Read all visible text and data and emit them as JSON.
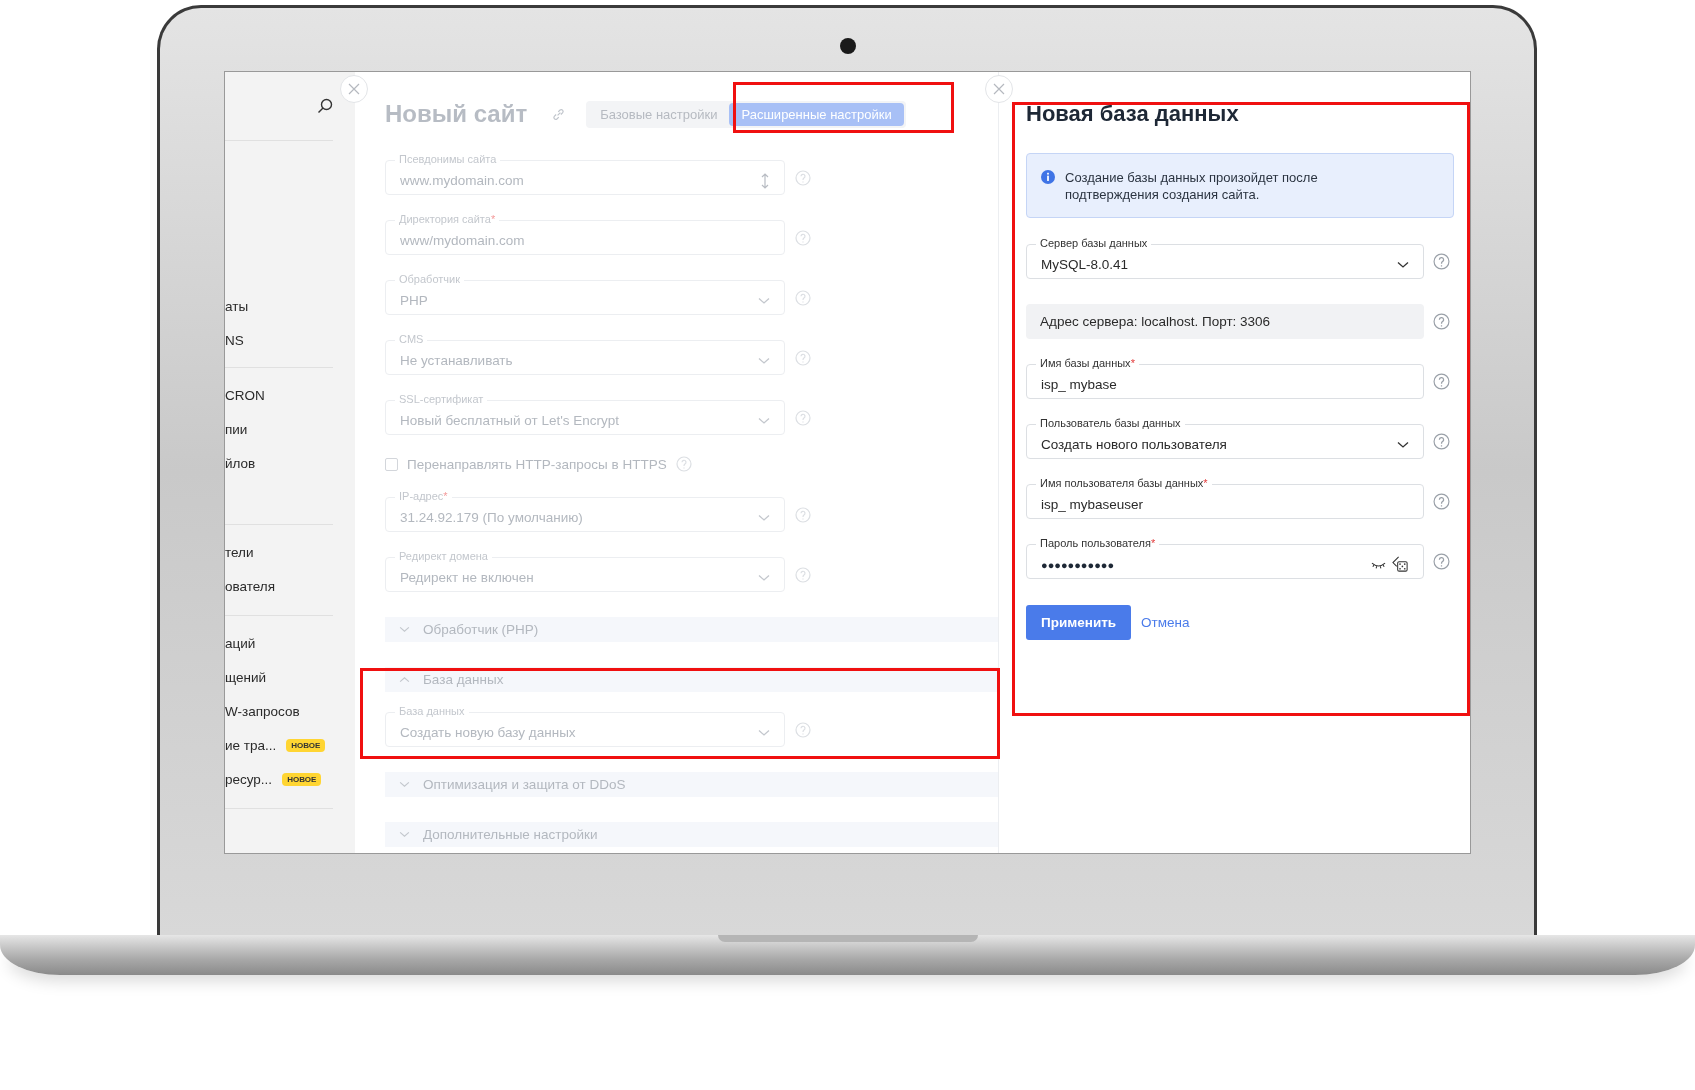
{
  "sidebar": {
    "groups": [
      {
        "items": [
          {
            "label": "аты"
          },
          {
            "label": "NS"
          }
        ]
      },
      {
        "items": [
          {
            "label": "CRON"
          },
          {
            "label": "пии"
          },
          {
            "label": "йлов"
          }
        ]
      },
      {
        "items": [
          {
            "label": "тели"
          },
          {
            "label": "ователя"
          }
        ]
      },
      {
        "items": [
          {
            "label": "аций"
          },
          {
            "label": "щений"
          },
          {
            "label": "W-запросов"
          },
          {
            "label": "ие тра...",
            "badge": "НОВОЕ"
          },
          {
            "label": "ресур...",
            "badge": "НОВОЕ"
          }
        ]
      }
    ]
  },
  "site_form": {
    "title": "Новый сайт",
    "tabs": [
      {
        "label": "Базовые настройки",
        "selected": false
      },
      {
        "label": "Расширенные настройки",
        "selected": true
      }
    ],
    "fields": [
      {
        "kind": "spin",
        "label": "Псевдонимы сайта",
        "value": "www.mydomain.com"
      },
      {
        "kind": "text",
        "label": "Директория сайта",
        "required_mark": "*",
        "value": "www/mydomain.com"
      },
      {
        "kind": "select",
        "label": "Обработчик",
        "value": "PHP"
      },
      {
        "kind": "select",
        "label": "CMS",
        "value": "Не устанавливать"
      },
      {
        "kind": "select",
        "label": "SSL-сертификат",
        "value": "Новый бесплатный от Let's Encrypt"
      }
    ],
    "https_redirect": {
      "label": "Перенаправлять HTTP-запросы в HTTPS",
      "checked": false
    },
    "fields_2": [
      {
        "kind": "select",
        "label": "IP-адрес",
        "required_mark": "*",
        "value": "31.24.92.179 (По умолчанию)"
      },
      {
        "kind": "select",
        "label": "Редирект домена",
        "value": "Редирект не включен"
      }
    ],
    "sections": [
      {
        "title": "Обработчик (PHP)",
        "expanded": false
      },
      {
        "title": "База данных",
        "expanded": true,
        "fields": [
          {
            "kind": "select",
            "label": "База данных",
            "value": "Создать новую базу данных"
          }
        ]
      },
      {
        "title": "Оптимизация и защита от DDoS",
        "expanded": false
      },
      {
        "title": "Дополнительные настройки",
        "expanded": false
      }
    ]
  },
  "database_panel": {
    "title": "Новая база данных",
    "notice": "Создание базы данных произойдет после подтверждения создания сайта.",
    "fields": [
      {
        "kind": "select",
        "label": "Сервер базы данных",
        "value": "MySQL-8.0.41"
      },
      {
        "kind": "static",
        "value": "Адрес сервера: localhost. Порт: 3306"
      },
      {
        "kind": "text",
        "label": "Имя базы данных",
        "required_mark": "*",
        "value": "isp_ mybase"
      },
      {
        "kind": "select",
        "label": "Пользователь базы данных",
        "value": "Создать нового пользователя"
      },
      {
        "kind": "text",
        "label": "Имя пользователя базы данных",
        "required_mark": "*",
        "value": "isp_ mybaseuser"
      },
      {
        "kind": "password",
        "label": "Пароль пользователя",
        "required_mark": "*",
        "value": "●●●●●●●●●●●"
      }
    ],
    "buttons": [
      {
        "kind": "primary",
        "label": "Применить"
      },
      {
        "kind": "link",
        "label": "Отмена"
      }
    ]
  }
}
